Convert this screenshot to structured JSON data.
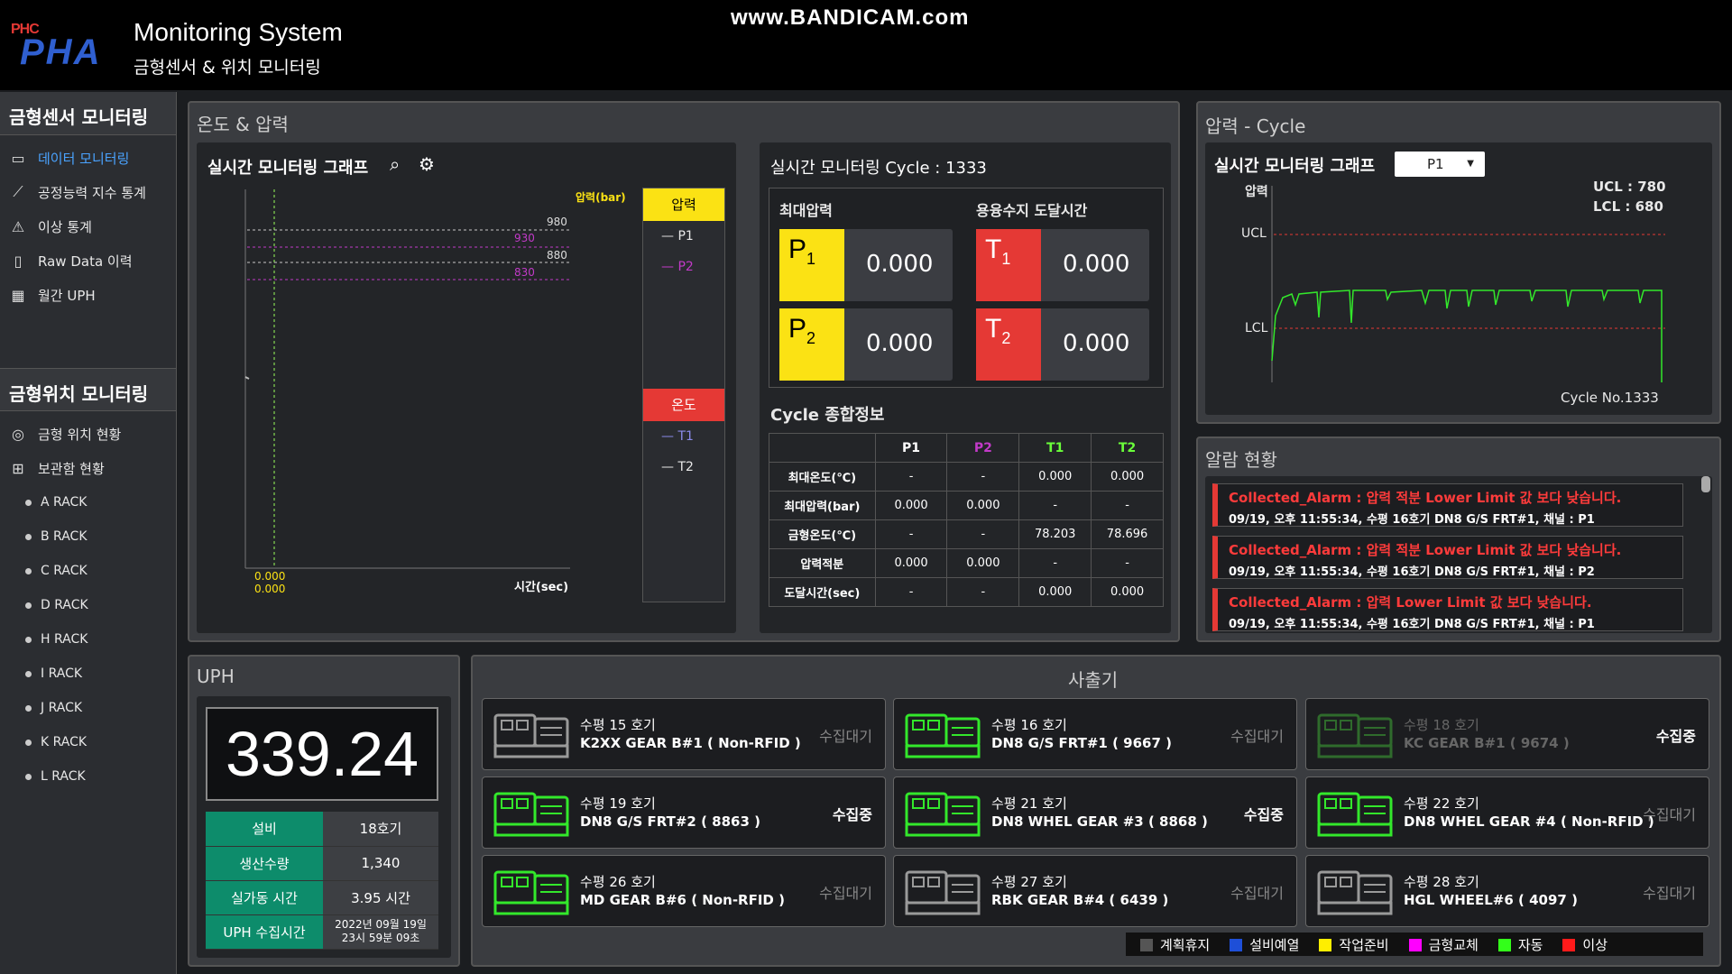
{
  "header": {
    "logo_small": "PHC",
    "logo_big": "PHA",
    "title": "Monitoring System",
    "subtitle": "금형센서 & 위치 모니터링",
    "watermark": "www.BANDICAM.com"
  },
  "sidebar": {
    "section1": "금형센서 모니터링",
    "items": [
      {
        "label": "데이터 모니터링",
        "icon": "monitor-icon"
      },
      {
        "label": "공정능력 지수 통계",
        "icon": "chart-line-icon"
      },
      {
        "label": "이상 통계",
        "icon": "warning-icon"
      },
      {
        "label": "Raw Data 이력",
        "icon": "document-icon"
      },
      {
        "label": "월간 UPH",
        "icon": "calendar-icon"
      }
    ],
    "section2": "금형위치 모니터링",
    "items2": [
      {
        "label": "금형 위치 현황",
        "icon": "location-icon"
      },
      {
        "label": "보관함 현황",
        "icon": "grid-icon"
      }
    ],
    "racks": [
      "A RACK",
      "B RACK",
      "C RACK",
      "D RACK",
      "H RACK",
      "I RACK",
      "J RACK",
      "K RACK",
      "L RACK"
    ]
  },
  "temp_pressure": {
    "title": "온도 & 압력",
    "graph_title": "실시간 모니터링 그래프",
    "y_label": "압력(bar)",
    "x_label": "시간(sec)",
    "lines": [
      "980",
      "930",
      "880",
      "830"
    ],
    "origin1": "0.000",
    "origin2": "0.000",
    "legend": {
      "pressure_head": "압력",
      "p1": "P1",
      "p2": "P2",
      "temp_head": "온도",
      "t1": "T1",
      "t2": "T2"
    }
  },
  "realtime": {
    "title": "실시간 모니터링 Cycle : 1333",
    "max_pressure": "최대압력",
    "melt_time": "용융수지 도달시간",
    "p1_tag": "P",
    "p1_sub": "1",
    "p1_val": "0.000",
    "p2_tag": "P",
    "p2_sub": "2",
    "p2_val": "0.000",
    "t1_tag": "T",
    "t1_sub": "1",
    "t1_val": "0.000",
    "t2_tag": "T",
    "t2_sub": "2",
    "t2_val": "0.000",
    "summary_title": "Cycle 종합정보",
    "cols": [
      "",
      "P1",
      "P2",
      "T1",
      "T2"
    ],
    "col_colors": [
      "#ffffff",
      "#ffffff",
      "#c23ac8",
      "#6aff3a",
      "#6aff3a"
    ],
    "rows": [
      [
        "최대온도(℃)",
        "-",
        "-",
        "0.000",
        "0.000"
      ],
      [
        "최대압력(bar)",
        "0.000",
        "0.000",
        "-",
        "-"
      ],
      [
        "금형온도(℃)",
        "-",
        "-",
        "78.203",
        "78.696"
      ],
      [
        "압력적분",
        "0.000",
        "0.000",
        "-",
        "-"
      ],
      [
        "도달시간(sec)",
        "-",
        "-",
        "0.000",
        "0.000"
      ]
    ]
  },
  "cycle": {
    "title": "압력 - Cycle",
    "graph_title": "실시간 모니터링 그래프",
    "select_value": "P1",
    "y_label": "압력",
    "ucl_text": "UCL : 780",
    "lcl_text": "LCL : 680",
    "ucl_label": "UCL",
    "lcl_label": "LCL",
    "cycle_no": "Cycle No.1333"
  },
  "alarms": {
    "title": "알람 현황",
    "items": [
      {
        "line1": "Collected_Alarm : 압력 적분 Lower Limit 값 보다 낮습니다.",
        "line2": "09/19, 오후 11:55:34, 수평 16호기 DN8 G/S FRT#1, 채널 : P1"
      },
      {
        "line1": "Collected_Alarm : 압력 적분 Lower Limit 값 보다 낮습니다.",
        "line2": "09/19, 오후 11:55:34, 수평 16호기 DN8 G/S FRT#1, 채널 : P2"
      },
      {
        "line1": "Collected_Alarm : 압력 Lower Limit 값 보다 낮습니다.",
        "line2": "09/19, 오후 11:55:34, 수평 16호기 DN8 G/S FRT#1, 채널 : P1"
      }
    ]
  },
  "uph": {
    "title": "UPH",
    "value": "339.24",
    "rows": [
      {
        "k": "설비",
        "v": "18호기"
      },
      {
        "k": "생산수량",
        "v": "1,340"
      },
      {
        "k": "실가동 시간",
        "v": "3.95 시간"
      },
      {
        "k": "UPH 수집시간",
        "v": "2022년 09월 19일",
        "v2": "23시 59분 09초"
      }
    ]
  },
  "machines": {
    "title": "사출기",
    "items": [
      {
        "t1": "수평 15 호기",
        "t2": "K2XX GEAR B#1 ( Non-RFID )",
        "st": "수집대기",
        "color": "#9a9a9a",
        "on": false,
        "dim": false
      },
      {
        "t1": "수평 16 호기",
        "t2": "DN8 G/S FRT#1 ( 9667 )",
        "st": "수집대기",
        "color": "#33e82b",
        "on": false,
        "dim": false
      },
      {
        "t1": "수평 18 호기",
        "t2": "KC GEAR B#1 ( 9674 )",
        "st": "수집중",
        "color": "#2f6b2c",
        "on": true,
        "dim": true
      },
      {
        "t1": "수평 19 호기",
        "t2": "DN8 G/S FRT#2 ( 8863 )",
        "st": "수집중",
        "color": "#33e82b",
        "on": true,
        "dim": false
      },
      {
        "t1": "수평 21 호기",
        "t2": "DN8 WHEL GEAR #3 ( 8868 )",
        "st": "수집중",
        "color": "#33e82b",
        "on": true,
        "dim": false
      },
      {
        "t1": "수평 22 호기",
        "t2": "DN8 WHEL GEAR #4 ( Non-RFID )",
        "st": "수집대기",
        "color": "#33e82b",
        "on": false,
        "dim": false
      },
      {
        "t1": "수평 26 호기",
        "t2": "MD GEAR B#6 ( Non-RFID )",
        "st": "수집대기",
        "color": "#33e82b",
        "on": false,
        "dim": false
      },
      {
        "t1": "수평 27 호기",
        "t2": "RBK GEAR B#4 ( 6439 )",
        "st": "수집대기",
        "color": "#9a9a9a",
        "on": false,
        "dim": false
      },
      {
        "t1": "수평 28 호기",
        "t2": "HGL WHEEL#6 ( 4097 )",
        "st": "수집대기",
        "color": "#9a9a9a",
        "on": false,
        "dim": false
      }
    ],
    "legend": [
      {
        "label": "계획휴지",
        "color": "#555555"
      },
      {
        "label": "설비예열",
        "color": "#1e4fd8"
      },
      {
        "label": "작업준비",
        "color": "#ffee00"
      },
      {
        "label": "금형교체",
        "color": "#ff00ff"
      },
      {
        "label": "자동",
        "color": "#33ff1a"
      },
      {
        "label": "이상",
        "color": "#ff1a1a"
      }
    ]
  }
}
